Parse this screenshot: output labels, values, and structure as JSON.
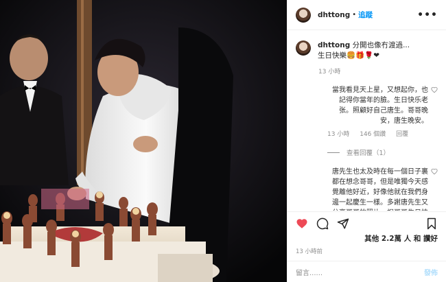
{
  "header": {
    "username": "dhttong",
    "separator": "•",
    "follow_label": "追蹤",
    "more_label": "•••"
  },
  "caption": {
    "username": "dhttong",
    "line1": "分開也像冇渡過...",
    "line2": "生日快樂🍔🎁🌹❤",
    "time": "13 小時"
  },
  "comments": [
    {
      "text": "當我看見天上星，又想起你，也記得你當年的臉。生日快乐老张。照顧好自己唐生。哥哥晚安，唐生晚安。",
      "time": "13 小時",
      "likes": "146 個讚",
      "reply_label": "回覆",
      "view_replies": "查看回覆（1）"
    },
    {
      "text": "唐先生也太及時在每一個日子裏都在想念哥哥，但是唯獨今天感覺離他好近，好像他就在我們身邊一起慶生一樣。多謝唐先生又分享哥哥的照片，祝哥哥生日快樂，滿滿晚安，也"
    }
  ],
  "actions": {
    "like_icon": "heart-filled-icon",
    "comment_icon": "comment-icon",
    "share_icon": "share-icon",
    "save_icon": "bookmark-icon",
    "like_color": "#ed4956"
  },
  "likes_text": "其他 2.2萬 人 和 讚好",
  "post_time": "13 小時前",
  "add_comment": {
    "placeholder": "留言......",
    "post_label": "發佈"
  }
}
